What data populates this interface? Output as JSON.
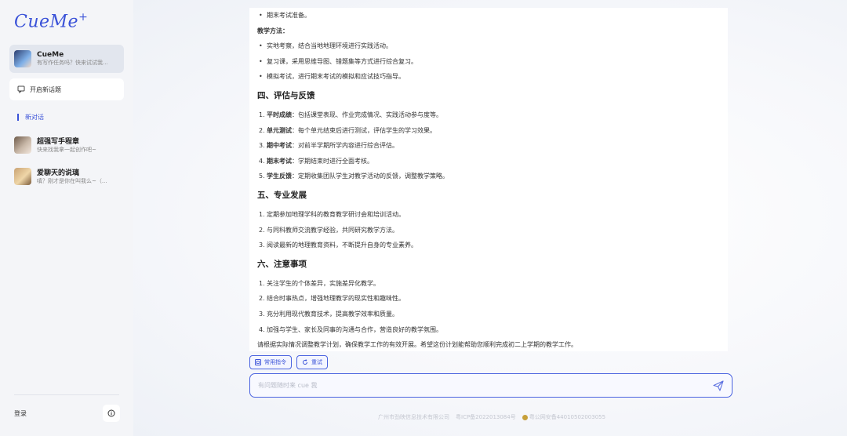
{
  "app": {
    "logo": "CueMe",
    "logo_suffix": "+"
  },
  "sidebar": {
    "agent": {
      "name": "CueMe",
      "subtitle": "有写作任务吗？快来试试我..."
    },
    "new_topic": "开启新话题",
    "new_chat": "新对话",
    "conversations": [
      {
        "title": "超强写手程章",
        "subtitle": "快来找我拿一起创作吧~"
      },
      {
        "title": "爱聊天的说璃",
        "subtitle": "嗔？刚才是你在叫我么~（..."
      }
    ],
    "login": "登录"
  },
  "content": {
    "top_bullet": "期末考试准备。",
    "method_label": "教学方法：",
    "method_items": [
      "实地考察，结合当地地理环境进行实践活动。",
      "复习课，采用思维导图、错题集等方式进行综合复习。",
      "模拟考试，进行期末考试的模拟和应试技巧指导。"
    ],
    "sections": [
      {
        "title": "四、评估与反馈",
        "items": [
          {
            "num": "1.",
            "bold": "平时成绩",
            "text": "：包括课堂表现、作业完成情况、实践活动参与度等。"
          },
          {
            "num": "2.",
            "bold": "单元测试",
            "text": "：每个单元结束后进行测试，评估学生的学习效果。"
          },
          {
            "num": "3.",
            "bold": "期中考试",
            "text": "：对前半学期所学内容进行综合评估。"
          },
          {
            "num": "4.",
            "bold": "期末考试",
            "text": "：学期结束时进行全面考核。"
          },
          {
            "num": "5.",
            "bold": "学生反馈",
            "text": "：定期收集团队学生对教学活动的反馈，调整教学策略。"
          }
        ]
      },
      {
        "title": "五、专业发展",
        "items": [
          {
            "num": "1.",
            "bold": "",
            "text": "定期参加地理学科的教育教学研讨会和培训活动。"
          },
          {
            "num": "2.",
            "bold": "",
            "text": "与同科教师交流教学经验，共同研究教学方法。"
          },
          {
            "num": "3.",
            "bold": "",
            "text": "阅读最新的地理教育资料，不断提升自身的专业素养。"
          }
        ]
      },
      {
        "title": "六、注意事项",
        "items": [
          {
            "num": "1.",
            "bold": "",
            "text": "关注学生的个体差异，实施差异化教学。"
          },
          {
            "num": "2.",
            "bold": "",
            "text": "结合时事热点，增强地理教学的现实性和趣味性。"
          },
          {
            "num": "3.",
            "bold": "",
            "text": "充分利用现代教育技术，提高教学效率和质量。"
          },
          {
            "num": "4.",
            "bold": "",
            "text": "加强与学生、家长及同事的沟通与合作，营造良好的教学氛围。"
          }
        ]
      }
    ],
    "closing": "请根据实际情况调整教学计划，确保教学工作的有效开展。希望这份计划能帮助您顺利完成初二上学期的教学工作。"
  },
  "actions": {
    "common_commands": "常用指令",
    "retry": "重试"
  },
  "input": {
    "placeholder": "有问题随时来 cue 我"
  },
  "footer": {
    "company": "广州市劲映信息技术有限公司",
    "icp": "粤ICP备2022013084号",
    "police": "粤公网安备44010502003055"
  }
}
